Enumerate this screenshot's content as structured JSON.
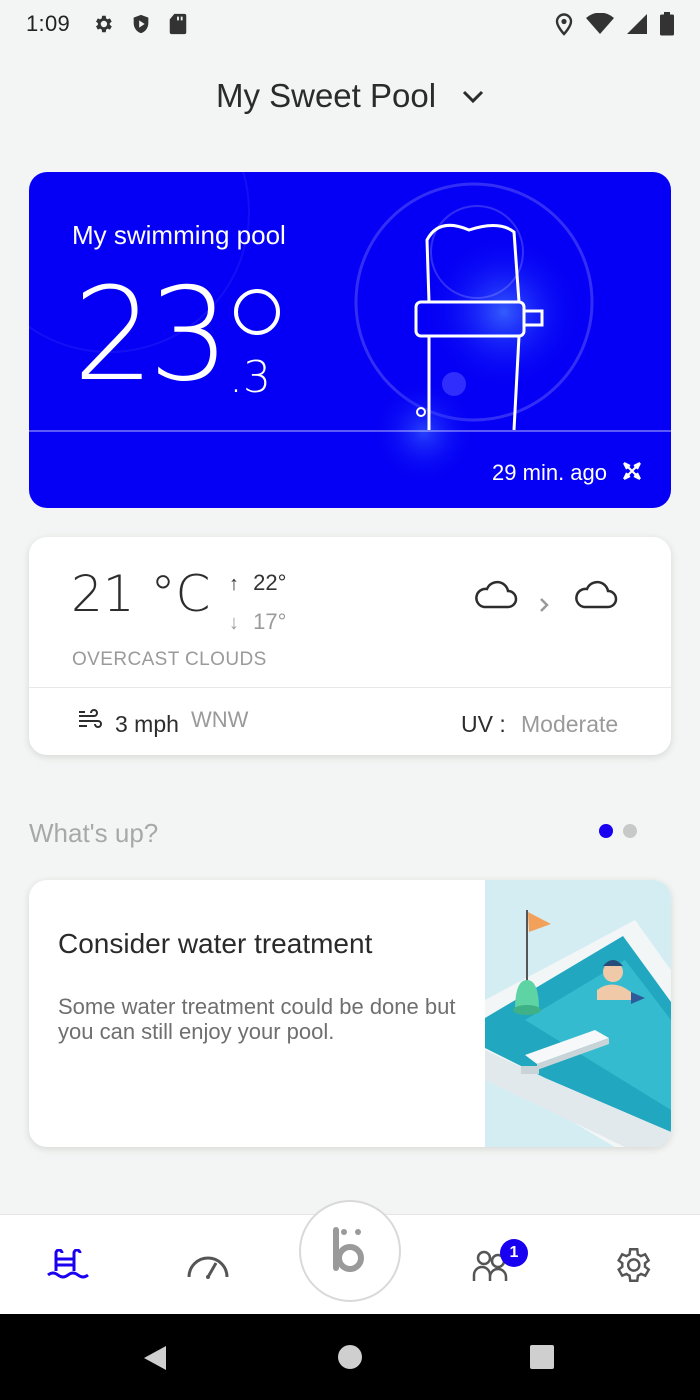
{
  "status_bar": {
    "time": "1:09",
    "left_icons": [
      "gear-icon",
      "shield-icon",
      "sd-card-icon"
    ],
    "right_icons": [
      "location-icon",
      "wifi-icon",
      "signal-icon",
      "battery-icon"
    ]
  },
  "header": {
    "pool_selector": "My Sweet Pool"
  },
  "pool_card": {
    "name": "My swimming pool",
    "temperature_main": "23",
    "temperature_decimal": ".3",
    "updated": "29 min. ago",
    "background_color": "#0500f5"
  },
  "weather": {
    "temperature": "21 °C",
    "high": "22°",
    "low": "17°",
    "high_arrow": "↑",
    "low_arrow": "↓",
    "description": "OVERCAST CLOUDS",
    "wind_speed": "3 mph",
    "wind_direction": "WNW",
    "uv_label": "UV :",
    "uv_value": "Moderate",
    "icons": [
      "cloud-icon",
      "chevron-right-icon",
      "cloud-icon"
    ]
  },
  "whats_up": {
    "title": "What's up?",
    "page_count": 2,
    "active_page": 1,
    "tip": {
      "title": "Consider water treatment",
      "body": "Some water treatment could be done but you can still enjoy your pool."
    }
  },
  "bottom_nav": {
    "items": [
      "pool-icon",
      "gauge-icon",
      "brand-b-icon",
      "friends-icon",
      "gear-icon"
    ],
    "friends_badge": "1",
    "accent_color": "#1a00f0"
  }
}
